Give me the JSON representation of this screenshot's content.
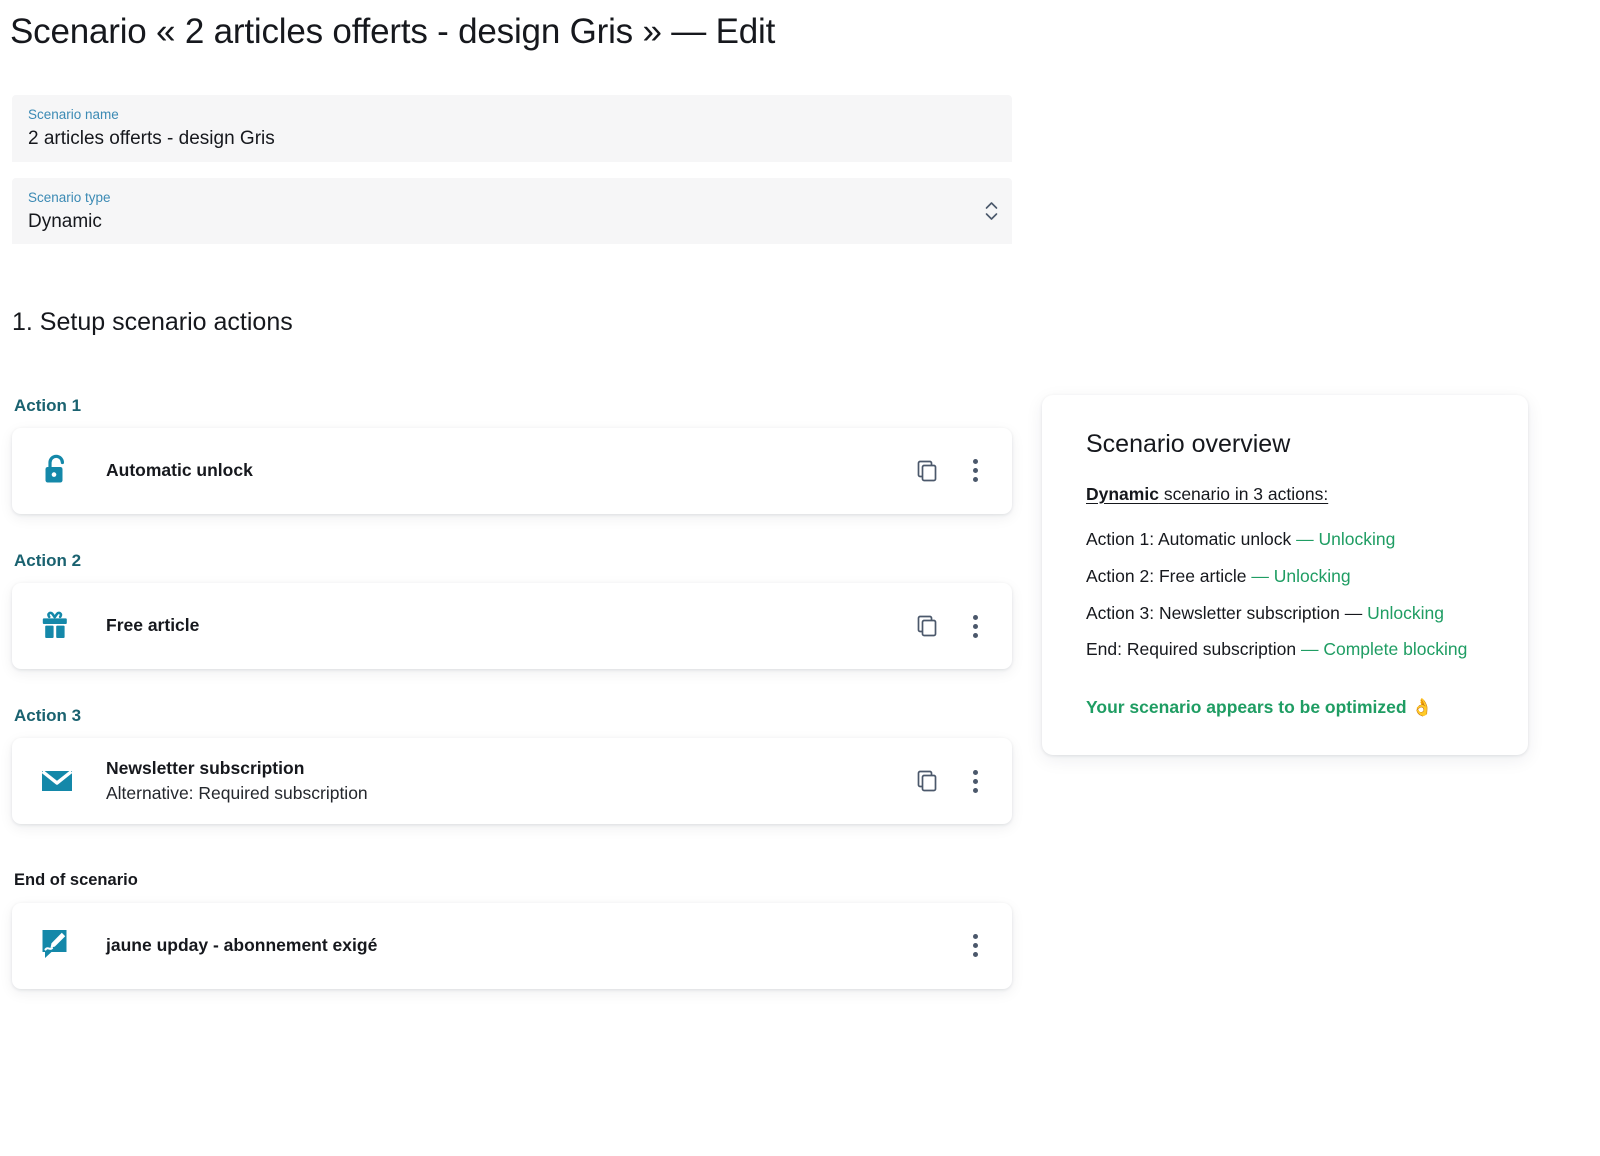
{
  "page_title": "Scenario « 2 articles offerts - design Gris » — Edit",
  "form": {
    "name_field": {
      "label": "Scenario name",
      "value": "2 articles offerts - design Gris"
    },
    "type_field": {
      "label": "Scenario type",
      "value": "Dynamic",
      "icon": "chevron-up-down-icon"
    }
  },
  "section": {
    "heading": "1. Setup scenario actions"
  },
  "actions": [
    {
      "label": "Action 1",
      "icon": "unlock-icon",
      "title": "Automatic unlock",
      "subtitle": "",
      "copy_icon": "copy-icon",
      "menu_icon": "more-vertical-icon"
    },
    {
      "label": "Action 2",
      "icon": "gift-icon",
      "title": "Free article",
      "subtitle": "",
      "copy_icon": "copy-icon",
      "menu_icon": "more-vertical-icon"
    },
    {
      "label": "Action 3",
      "icon": "envelope-icon",
      "title": "Newsletter subscription",
      "subtitle": "Alternative: Required subscription",
      "copy_icon": "copy-icon",
      "menu_icon": "more-vertical-icon"
    }
  ],
  "end_of_scenario": {
    "label": "End of scenario",
    "icon": "sign-document-icon",
    "title": "jaune upday - abonnement exigé",
    "menu_icon": "more-vertical-icon"
  },
  "overview": {
    "title": "Scenario overview",
    "lead_bold": "Dynamic",
    "lead_rest": " scenario in 3 actions:",
    "lines": [
      {
        "main": "Action 1: Automatic unlock ",
        "accent": "— Unlocking"
      },
      {
        "main": "Action 2: Free article ",
        "accent": "— Unlocking"
      },
      {
        "main": "Action 3: Newsletter subscription — ",
        "accent": "Unlocking"
      },
      {
        "main": "End: Required subscription ",
        "accent": "— Complete blocking"
      }
    ],
    "footer": "Your scenario appears to be optimized",
    "footer_emoji": "👌"
  },
  "colors": {
    "accent_teal": "#1488a9",
    "label_teal": "#1a6270",
    "field_label_blue": "#3b8ab4",
    "green": "#1f9d63",
    "slate": "#4b586b"
  }
}
